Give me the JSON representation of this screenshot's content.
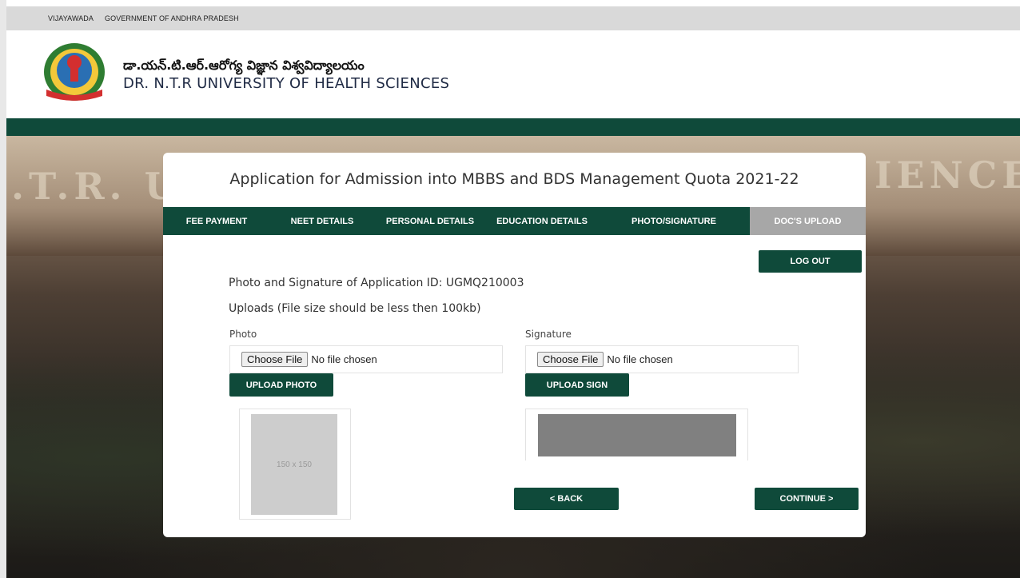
{
  "topbar": {
    "city": "VIJAYAWADA",
    "govt": "GOVERNMENT OF ANDHRA PRADESH"
  },
  "header": {
    "name_telugu": "డా.యన్.టి.ఆర్.ఆరోగ్య విజ్ఞాన విశ్వవిద్యాలయం",
    "name_english": "DR. N.T.R UNIVERSITY OF HEALTH SCIENCES"
  },
  "background": {
    "letters_left": ".T.R. U",
    "letters_right": "IENCES"
  },
  "card": {
    "title": "Application for Admission into MBBS and BDS Management Quota 2021-22",
    "tabs": [
      {
        "label": "FEE PAYMENT"
      },
      {
        "label": "NEET DETAILS"
      },
      {
        "label": "PERSONAL DETAILS"
      },
      {
        "label": "EDUCATION DETAILS"
      },
      {
        "label": "PHOTO/SIGNATURE"
      },
      {
        "label": "DOC'S UPLOAD"
      }
    ],
    "logout_label": "LOG OUT",
    "app_id_line": "Photo and Signature of Application ID: UGMQ210003",
    "uploads_note": "Uploads (File size should be less then 100kb)",
    "photo": {
      "label": "Photo",
      "choose_label": "Choose File",
      "no_file_text": "No file chosen",
      "upload_label": "UPLOAD PHOTO",
      "placeholder_text": "150 x 150"
    },
    "signature": {
      "label": "Signature",
      "choose_label": "Choose File",
      "no_file_text": "No file chosen",
      "upload_label": "UPLOAD SIGN"
    },
    "back_label": "< BACK",
    "continue_label": "CONTINUE >"
  },
  "colors": {
    "brand_green": "#0f4a3a",
    "active_tab": "#a7a7a7",
    "topbar": "#d9d9d9"
  }
}
